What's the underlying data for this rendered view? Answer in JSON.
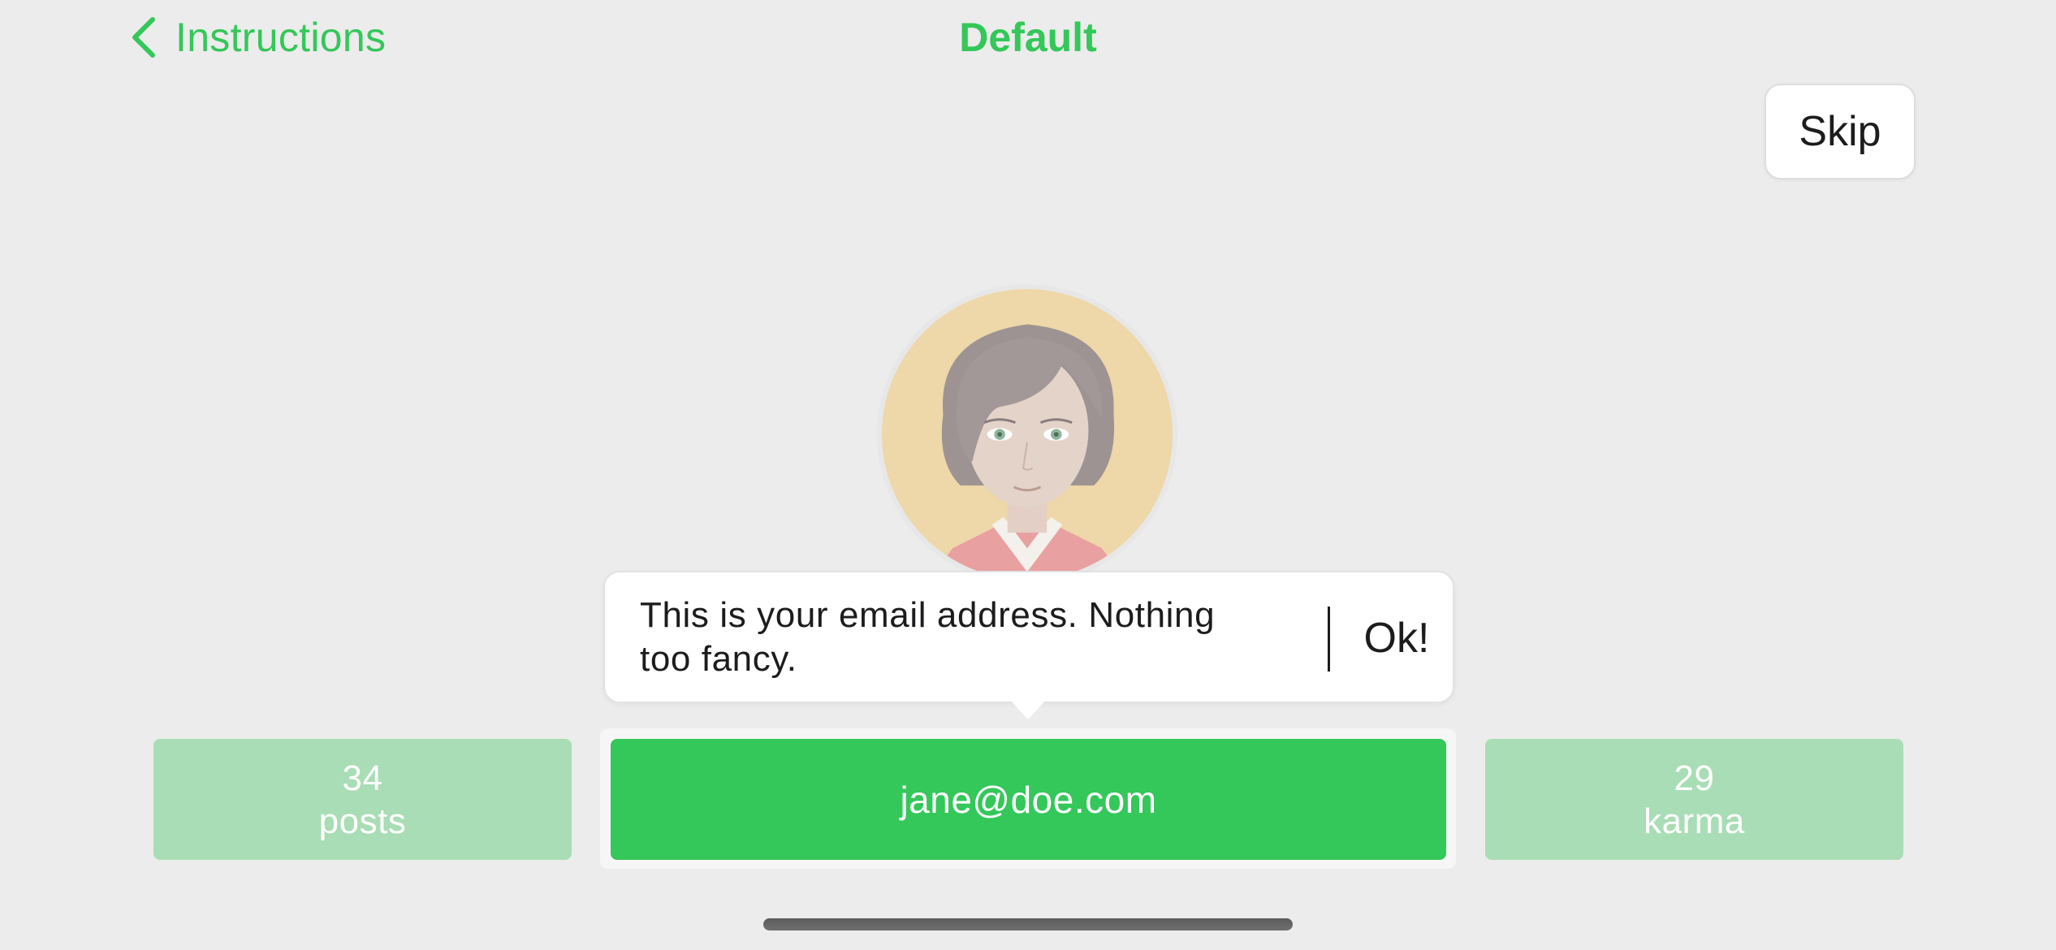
{
  "nav": {
    "back_label": "Instructions",
    "back_icon": "chevron-left-icon",
    "title": "Default"
  },
  "skip_label": "Skip",
  "profile": {
    "avatar_icon": "avatar-woman-icon",
    "email": "jane@doe.com",
    "stats": [
      {
        "value": "34",
        "label": "posts"
      },
      {
        "value": "29",
        "label": "karma"
      }
    ]
  },
  "tooltip": {
    "text": "This is your email address. Nothing too fancy.",
    "ok_label": "Ok!"
  },
  "colors": {
    "accent": "#34c759",
    "stat_dimmed": "#a9ddb5",
    "background": "#ececec"
  }
}
